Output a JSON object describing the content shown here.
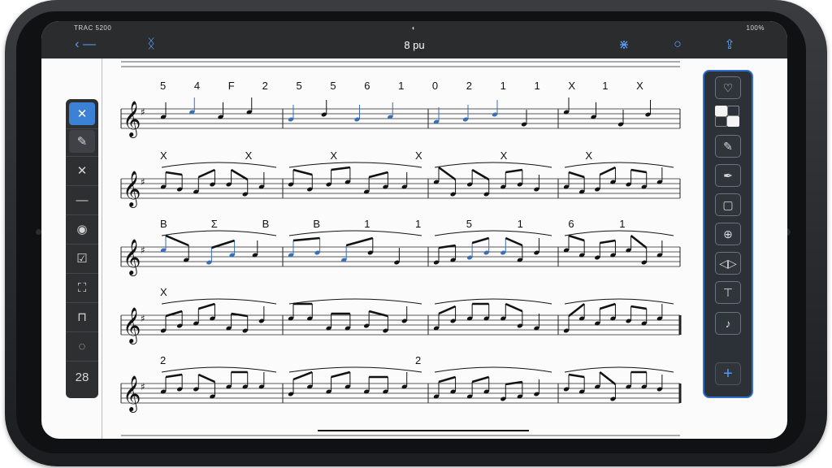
{
  "status_bar": {
    "left": "TRAC 5200",
    "right": "100%"
  },
  "nav": {
    "back_label": "‹ —",
    "title": "8 pu",
    "title_color": "#ffffff",
    "accent": "#5aa0ff"
  },
  "left_toolbar": {
    "items": [
      {
        "name": "close",
        "icon": "close-icon",
        "glyph": "✕",
        "state": "active"
      },
      {
        "name": "pencil",
        "icon": "pencil-icon",
        "glyph": "✎",
        "state": "selected"
      },
      {
        "name": "cross",
        "icon": "x-icon",
        "glyph": "✕",
        "state": ""
      },
      {
        "name": "line",
        "icon": "line-icon",
        "glyph": "—",
        "state": ""
      },
      {
        "name": "eye",
        "icon": "eye-icon",
        "glyph": "◉",
        "state": ""
      },
      {
        "name": "check",
        "icon": "check-box-icon",
        "glyph": "☑",
        "state": ""
      },
      {
        "name": "select",
        "icon": "selection-icon",
        "glyph": "⛶",
        "state": ""
      },
      {
        "name": "frame",
        "icon": "frame-icon",
        "glyph": "⊓",
        "state": ""
      },
      {
        "name": "lasso",
        "icon": "lasso-icon",
        "glyph": "◌",
        "state": ""
      },
      {
        "name": "notes",
        "icon": "notes-icon",
        "glyph": "28",
        "state": ""
      }
    ]
  },
  "right_toolbar": {
    "items": [
      {
        "name": "tag",
        "icon": "heart-tag-icon",
        "glyph": "♡"
      },
      {
        "name": "edit",
        "icon": "edit-icon",
        "glyph": "✎"
      },
      {
        "name": "pen",
        "icon": "pen-icon",
        "glyph": "✒"
      },
      {
        "name": "page",
        "icon": "page-icon",
        "glyph": "▢"
      },
      {
        "name": "globe",
        "icon": "globe-icon",
        "glyph": "⊕"
      },
      {
        "name": "flip",
        "icon": "flip-icon",
        "glyph": "◁▷"
      },
      {
        "name": "stamp",
        "icon": "stamp-icon",
        "glyph": "⊤"
      },
      {
        "name": "music",
        "icon": "music-icon",
        "glyph": "♪"
      }
    ],
    "add_label": "+"
  },
  "score": {
    "staff_count": 5,
    "rows": [
      {
        "numbers": [
          "5",
          "4",
          "F",
          "2",
          "5",
          "5",
          "6",
          "1",
          "0",
          "2",
          "1",
          "1",
          "X",
          "1",
          "X"
        ]
      },
      {
        "numbers": [
          "X",
          "X",
          "X",
          "X",
          "X",
          "X"
        ]
      },
      {
        "numbers": [
          "B",
          "Σ",
          "B",
          "B",
          "1",
          "1",
          "5",
          "1",
          "6",
          "1"
        ]
      },
      {
        "numbers": [
          "X"
        ]
      },
      {
        "numbers": [
          "2",
          "2"
        ]
      }
    ]
  }
}
